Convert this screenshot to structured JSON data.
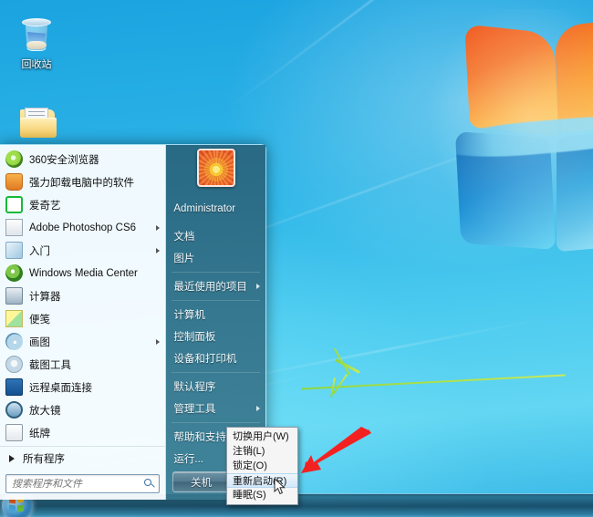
{
  "desktop": {
    "icons": [
      {
        "name": "recycle-bin",
        "label": "回收站"
      },
      {
        "name": "folder",
        "label": ""
      }
    ]
  },
  "start_menu": {
    "programs": [
      {
        "icon": "ie-browser-icon",
        "label": "360安全浏览器",
        "has_submenu": false
      },
      {
        "icon": "uninstaller-icon",
        "label": "强力卸载电脑中的软件",
        "has_submenu": false
      },
      {
        "icon": "iqiyi-icon",
        "label": "爱奇艺",
        "has_submenu": false
      },
      {
        "icon": "photoshop-icon",
        "label": "Adobe Photoshop CS6",
        "has_submenu": true
      },
      {
        "icon": "getting-started-icon",
        "label": "入门",
        "has_submenu": true
      },
      {
        "icon": "media-center-icon",
        "label": "Windows Media Center",
        "has_submenu": false
      },
      {
        "icon": "calculator-icon",
        "label": "计算器",
        "has_submenu": false
      },
      {
        "icon": "sticky-notes-icon",
        "label": "便笺",
        "has_submenu": false
      },
      {
        "icon": "paint-icon",
        "label": "画图",
        "has_submenu": true
      },
      {
        "icon": "snipping-tool-icon",
        "label": "截图工具",
        "has_submenu": false
      },
      {
        "icon": "remote-desktop-icon",
        "label": "远程桌面连接",
        "has_submenu": false
      },
      {
        "icon": "magnifier-icon",
        "label": "放大镜",
        "has_submenu": false
      },
      {
        "icon": "solitaire-icon",
        "label": "纸牌",
        "has_submenu": false
      }
    ],
    "all_programs_label": "所有程序",
    "search": {
      "placeholder": "搜索程序和文件",
      "value": ""
    },
    "user": {
      "name": "Administrator",
      "avatar": "orange-flower-avatar"
    },
    "right_items": [
      {
        "label": "文档",
        "has_submenu": false
      },
      {
        "label": "图片",
        "has_submenu": false
      },
      {
        "label": "最近使用的项目",
        "has_submenu": true
      },
      {
        "label": "计算机",
        "has_submenu": false
      },
      {
        "label": "控制面板",
        "has_submenu": false
      },
      {
        "label": "设备和打印机",
        "has_submenu": false
      },
      {
        "label": "默认程序",
        "has_submenu": false
      },
      {
        "label": "管理工具",
        "has_submenu": true
      },
      {
        "label": "帮助和支持",
        "has_submenu": false
      },
      {
        "label": "运行...",
        "has_submenu": false
      }
    ],
    "shutdown": {
      "label": "关机",
      "caret": "chevron-right-icon"
    },
    "power_menu": {
      "items": [
        {
          "label": "切换用户(W)",
          "selected": false
        },
        {
          "label": "注销(L)",
          "selected": false
        },
        {
          "label": "锁定(O)",
          "selected": false
        },
        {
          "label": "重新启动(R)",
          "selected": true
        },
        {
          "label": "睡眠(S)",
          "selected": false
        }
      ]
    }
  },
  "annotation": {
    "arrow": "red-arrow-pointing-to-restart",
    "color": "#f42121"
  },
  "taskbar": {
    "start_button": "windows-start-orb"
  },
  "colors": {
    "desktop_blue": "#2fb6e8",
    "menu_right_panel": "#3a6f86",
    "menu_left_panel": "#fcfdff",
    "accent_red": "#f42121",
    "selection_blue": "#d3e8f9"
  }
}
